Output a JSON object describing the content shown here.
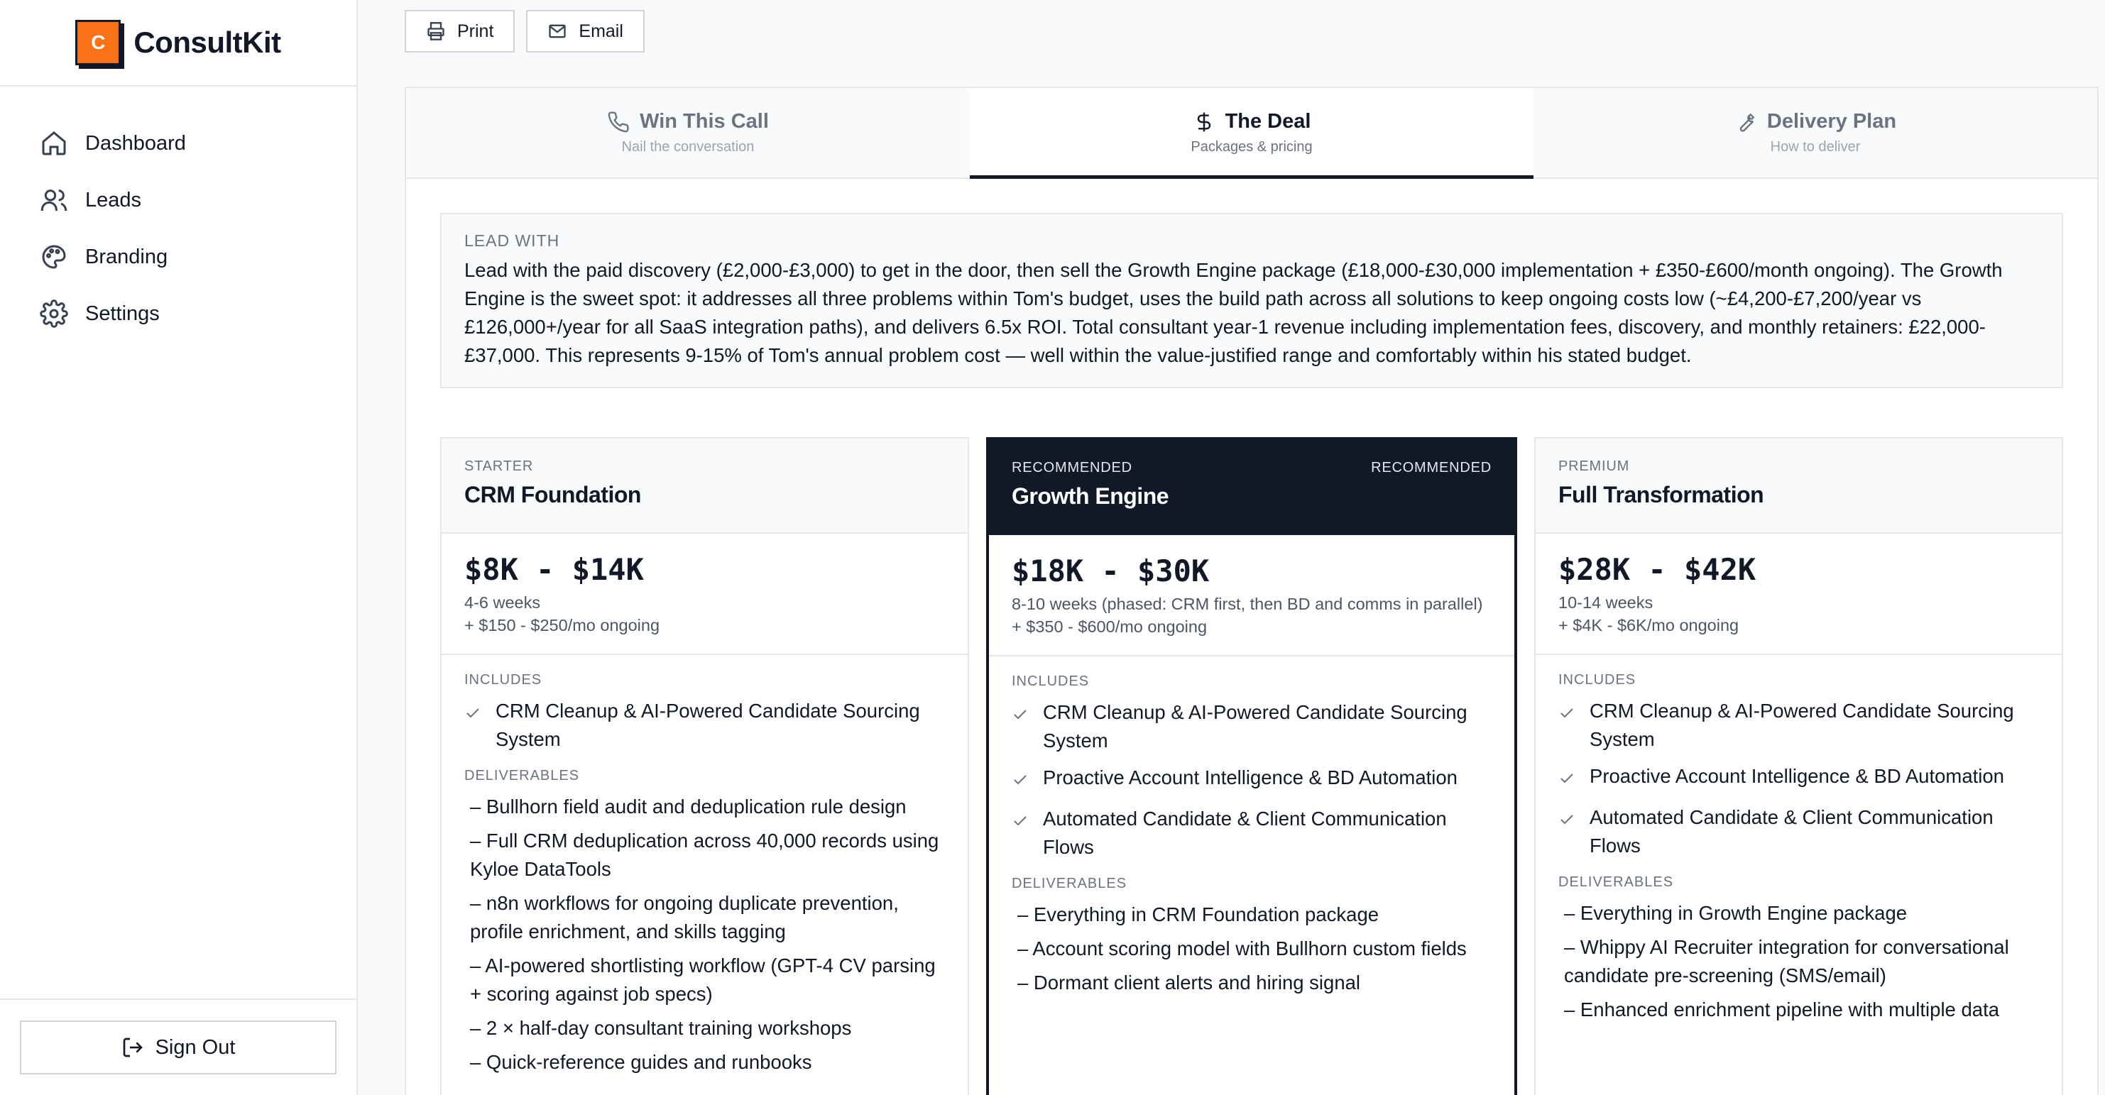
{
  "brand": {
    "logo_letter": "C",
    "name": "ConsultKit",
    "accent": "#f97316"
  },
  "sidebar": {
    "items": [
      {
        "label": "Dashboard",
        "icon": "home-icon"
      },
      {
        "label": "Leads",
        "icon": "users-icon"
      },
      {
        "label": "Branding",
        "icon": "palette-icon"
      },
      {
        "label": "Settings",
        "icon": "gear-icon"
      }
    ],
    "sign_out": "Sign Out"
  },
  "toolbar": {
    "print": "Print",
    "email": "Email"
  },
  "tabs": [
    {
      "title": "Win This Call",
      "subtitle": "Nail the conversation",
      "icon": "phone-icon",
      "active": false
    },
    {
      "title": "The Deal",
      "subtitle": "Packages & pricing",
      "icon": "dollar-icon",
      "active": true
    },
    {
      "title": "Delivery Plan",
      "subtitle": "How to deliver",
      "icon": "wrench-icon",
      "active": false
    }
  ],
  "lead_with": {
    "label": "LEAD WITH",
    "text": "Lead with the paid discovery (£2,000-£3,000) to get in the door, then sell the Growth Engine package (£18,000-£30,000 implementation + £350-£600/month ongoing). The Growth Engine is the sweet spot: it addresses all three problems within Tom's budget, uses the build path across all solutions to keep ongoing costs low (~£4,200-£7,200/year vs £126,000+/year for all SaaS integration paths), and delivers 6.5x ROI. Total consultant year-1 revenue including implementation fees, discovery, and monthly retainers: £22,000-£37,000. This represents 9-15% of Tom's annual problem cost — well within the value-justified range and comfortably within his stated budget."
  },
  "packages": [
    {
      "tier": "STARTER",
      "badge": "",
      "title": "CRM Foundation",
      "price": "$8K - $14K",
      "timeline": "4-6 weeks",
      "ongoing": "+ $150 - $250/mo ongoing",
      "includes_label": "INCLUDES",
      "includes": [
        "CRM Cleanup & AI-Powered Candidate Sourcing System"
      ],
      "deliverables_label": "DELIVERABLES",
      "deliverables": [
        "– Bullhorn field audit and deduplication rule design",
        "– Full CRM deduplication across 40,000 records using Kyloe DataTools",
        "– n8n workflows for ongoing duplicate prevention, profile enrichment, and skills tagging",
        "– AI-powered shortlisting workflow (GPT-4 CV parsing + scoring against job specs)",
        "– 2 × half-day consultant training workshops",
        "– Quick-reference guides and runbooks"
      ]
    },
    {
      "tier": "RECOMMENDED",
      "badge": "RECOMMENDED",
      "title": "Growth Engine",
      "price": "$18K - $30K",
      "timeline": "8-10 weeks (phased: CRM first, then BD and comms in parallel)",
      "ongoing": "+ $350 - $600/mo ongoing",
      "includes_label": "INCLUDES",
      "includes": [
        "CRM Cleanup & AI-Powered Candidate Sourcing System",
        "Proactive Account Intelligence & BD Automation",
        "Automated Candidate & Client Communication Flows"
      ],
      "deliverables_label": "DELIVERABLES",
      "deliverables": [
        "– Everything in CRM Foundation package",
        "– Account scoring model with Bullhorn custom fields",
        "– Dormant client alerts and hiring signal"
      ]
    },
    {
      "tier": "PREMIUM",
      "badge": "",
      "title": "Full Transformation",
      "price": "$28K - $42K",
      "timeline": "10-14 weeks",
      "ongoing": "+ $4K - $6K/mo ongoing",
      "includes_label": "INCLUDES",
      "includes": [
        "CRM Cleanup & AI-Powered Candidate Sourcing System",
        "Proactive Account Intelligence & BD Automation",
        "Automated Candidate & Client Communication Flows"
      ],
      "deliverables_label": "DELIVERABLES",
      "deliverables": [
        "– Everything in Growth Engine package",
        "– Whippy AI Recruiter integration for conversational candidate pre-screening (SMS/email)",
        "– Enhanced enrichment pipeline with multiple data"
      ]
    }
  ]
}
